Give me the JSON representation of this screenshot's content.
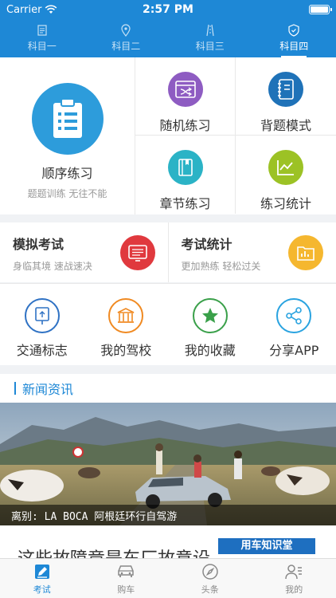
{
  "status": {
    "carrier": "Carrier",
    "time": "2:57 PM"
  },
  "subjects": [
    {
      "label": "科目一",
      "active": false
    },
    {
      "label": "科目二",
      "active": false
    },
    {
      "label": "科目三",
      "active": false
    },
    {
      "label": "科目四",
      "active": true
    }
  ],
  "practice": {
    "sequence": {
      "title": "顺序练习",
      "subtitle": "题题训练 无往不能"
    },
    "random": "随机练习",
    "recite": "背题模式",
    "chapter": "章节练习",
    "stats": "练习统计"
  },
  "exam": {
    "mock": {
      "title": "模拟考试",
      "subtitle": "身临其境 速战速决"
    },
    "stats": {
      "title": "考试统计",
      "subtitle": "更加熟练 轻松过关"
    }
  },
  "tools": [
    {
      "label": "交通标志"
    },
    {
      "label": "我的驾校"
    },
    {
      "label": "我的收藏"
    },
    {
      "label": "分享APP"
    }
  ],
  "news": {
    "section_title": "新闻资讯",
    "featured_caption": "离别: LA BOCA 阿根廷环行自驾游",
    "badge": "用车知识堂",
    "next_headline": "这些故障竟是车厂故意设"
  },
  "bottom_nav": [
    {
      "label": "考试",
      "active": true
    },
    {
      "label": "购车",
      "active": false
    },
    {
      "label": "头条",
      "active": false
    },
    {
      "label": "我的",
      "active": false
    }
  ],
  "colors": {
    "primary": "#1e88d6",
    "random": "#8e5cc2",
    "recite": "#1f72b8",
    "chapter": "#2bb3c6",
    "stats": "#9cc225",
    "mock": "#e0393e",
    "exam_stats": "#f5b72f",
    "signs": "#2f72c4",
    "school": "#f08a22",
    "favorites": "#3aa04a",
    "share": "#2aa3e0"
  }
}
